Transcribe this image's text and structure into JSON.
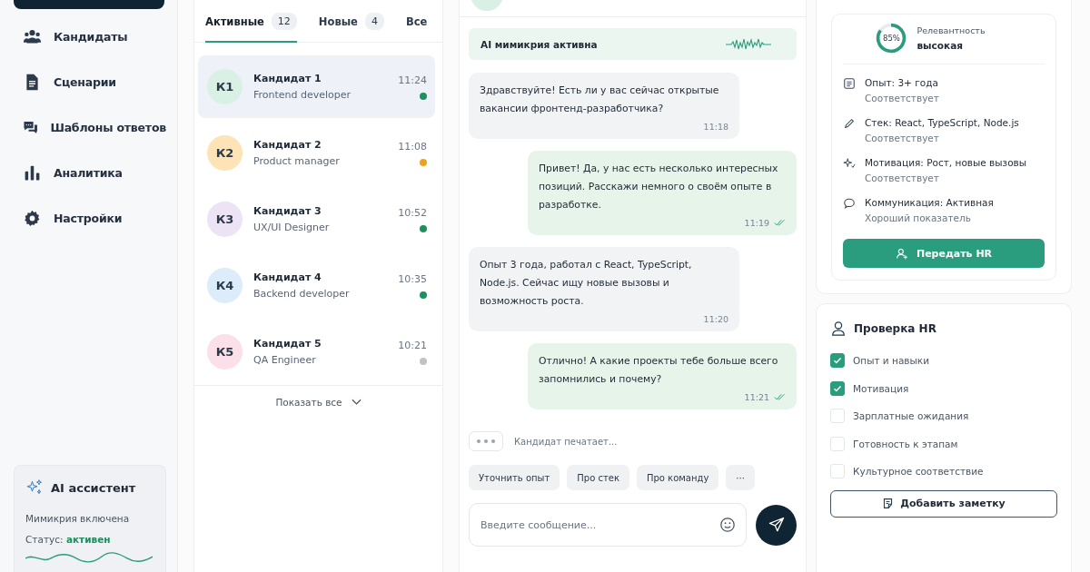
{
  "nav": [
    {
      "label": "Кандидаты"
    },
    {
      "label": "Сценарии"
    },
    {
      "label": "Шаблоны ответов"
    },
    {
      "label": "Аналитика"
    },
    {
      "label": "Настройки"
    }
  ],
  "assistant": {
    "title": "AI ассистент",
    "mimicry": "Мимикрия включена",
    "status_label": "Статус:",
    "status_value": "активен"
  },
  "tabs": [
    {
      "label": "Активные",
      "count": "12",
      "selected": true
    },
    {
      "label": "Новые",
      "count": "4",
      "selected": false
    },
    {
      "label": "Все",
      "selected": false
    }
  ],
  "candidates": [
    {
      "initials": "К1",
      "name": "Кандидат 1",
      "role": "Frontend developer",
      "time": "11:24",
      "color": "#1e8f5e",
      "selected": true
    },
    {
      "initials": "К2",
      "name": "Кандидат 2",
      "role": "Product manager",
      "time": "11:08",
      "color": "#f0a020",
      "selected": false
    },
    {
      "initials": "К3",
      "name": "Кандидат 3",
      "role": "UX/UI Designer",
      "time": "10:52",
      "color": "#1e8f5e",
      "selected": false
    },
    {
      "initials": "К4",
      "name": "Кандидат 4",
      "role": "Backend developer",
      "time": "10:35",
      "color": "#1e8f5e",
      "selected": false
    },
    {
      "initials": "К5",
      "name": "Кандидат 5",
      "role": "QA Engineer",
      "time": "10:21",
      "color": "#bfc3c8",
      "selected": false
    }
  ],
  "show_all": "Показать все",
  "banner": {
    "text": "AI мимикрия активна"
  },
  "messages": [
    {
      "kind": "incoming",
      "text": "Здравствуйте! Есть ли у вас сейчас открытые вакансии фронтенд-разработчика?",
      "time": "11:18"
    },
    {
      "kind": "outgoing",
      "text": "Привет! Да, у нас есть несколько интересных позиций. Расскажи немного о своём опыте в разработке.",
      "time": "11:19",
      "read": true
    },
    {
      "kind": "incoming",
      "text": "Опыт 3 года, работал с React, TypeScript, Node.js. Сейчас ищу новые вызовы и возможность роста.",
      "time": "11:20"
    },
    {
      "kind": "outgoing",
      "text": "Отлично! А какие проекты тебе больше всего запомнились и почему?",
      "time": "11:21",
      "read": true
    }
  ],
  "typing": "Кандидат печатает...",
  "quick_replies": [
    "Уточнить опыт",
    "Про стек",
    "Про команду",
    "···"
  ],
  "composer": {
    "placeholder": "Введите сообщение..."
  },
  "relevance": {
    "percent": "85%",
    "level": 0.85,
    "label": "Релевантность",
    "value": "высокая"
  },
  "criteria": [
    {
      "title": "Опыт: 3+ года",
      "note": "Соответствует"
    },
    {
      "title": "Стек: React, TypeScript, Node.js",
      "note": "Соответствует"
    },
    {
      "title": "Мотивация: Рост, новые вызовы",
      "note": "Соответствует"
    },
    {
      "title": "Коммуникация: Активная",
      "note": "Хороший показатель"
    }
  ],
  "handoff_button": "Передать HR",
  "hr_check": {
    "title": "Проверка HR",
    "items": [
      {
        "label": "Опыт и навыки",
        "checked": true
      },
      {
        "label": "Мотивация",
        "checked": true
      },
      {
        "label": "Зарплатные ожидания",
        "checked": false
      },
      {
        "label": "Готовность к этапам",
        "checked": false
      },
      {
        "label": "Культурное соответствие",
        "checked": false
      }
    ]
  },
  "note_button": "Добавить заметку"
}
